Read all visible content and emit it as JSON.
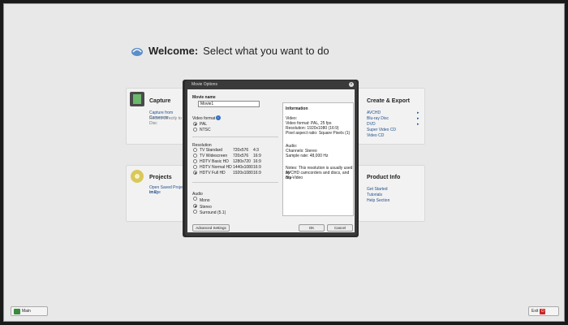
{
  "welcome": {
    "bold": "Welcome:",
    "rest": "Select what you want to do"
  },
  "capture": {
    "title": "Capture",
    "links": [
      "Capture from Camera or",
      "Record Directly to Disc"
    ]
  },
  "projects": {
    "title": "Projects",
    "links": [
      "Open Saved Project or D",
      "Image"
    ]
  },
  "create_export": {
    "title": "Create & Export",
    "links": [
      "AVCHD",
      "Blu-ray Disc",
      "DVD",
      "Super Video CD",
      "Video CD"
    ]
  },
  "product_info": {
    "title": "Product Info",
    "links": [
      "Get Started",
      "Tutorials",
      "Help Section"
    ]
  },
  "dialog": {
    "title": "Movie Options",
    "movie_name_label": "Movie name",
    "movie_name_value": "Movie1",
    "video_format_label": "Video format",
    "formats": [
      "PAL",
      "NTSC"
    ],
    "resolution_label": "Resolution",
    "resolutions": [
      {
        "name": "TV Standard",
        "size": "720x576",
        "ratio": "4:3",
        "selected": false
      },
      {
        "name": "TV Widescreen",
        "size": "720x576",
        "ratio": "16:9",
        "selected": false
      },
      {
        "name": "HDTV Basic HD",
        "size": "1280x720",
        "ratio": "16:9",
        "selected": false
      },
      {
        "name": "HDTV Normal HD",
        "size": "1440x1080",
        "ratio": "16:9",
        "selected": false
      },
      {
        "name": "HDTV Full HD",
        "size": "1920x1080",
        "ratio": "16:9",
        "selected": true
      }
    ],
    "audio_label": "Audio",
    "audio_options": [
      "Mono",
      "Stereo",
      "Surround (5.1)"
    ],
    "info_title": "Information",
    "info_video": [
      "Video:",
      "Video format: PAL, 25 fps",
      "Resolution: 1920x1080 (16:9)",
      "Pixel aspect ratio: Square Pixels (1)"
    ],
    "info_audio": [
      "Audio:",
      "Channels: Stereo",
      "Sample rate: 48,000 Hz"
    ],
    "info_notes": [
      "Notes: This resolution is usually used by",
      "AVCHD camcorders and discs, and Blu-",
      "ray Video"
    ],
    "advanced_button": "Advanced Settings",
    "ok_button": "OK",
    "cancel_button": "Cancel"
  },
  "bottom": {
    "mini_label": "Main",
    "exit_label": "Exit"
  }
}
